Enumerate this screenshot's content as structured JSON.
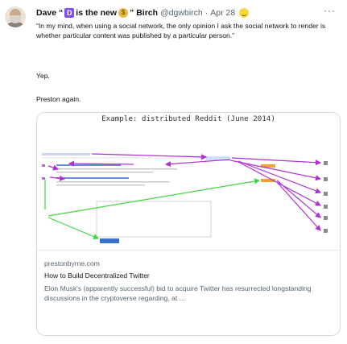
{
  "tweet": {
    "author_name_pre": "Dave “",
    "author_badge": "D",
    "author_name_mid": " is the new ",
    "author_bag": "$",
    "author_name_post": "” Birch",
    "handle": "@dgwbirch",
    "separator": "·",
    "date": "Apr 28",
    "more_label": "···",
    "quote": "“In my mind, when using a social network, the only opinion I ask the social network to render is whether particular content was published by a particular person.”",
    "reply1": "Yep.",
    "reply2": "Preston again."
  },
  "card": {
    "image_caption": "Example: distributed Reddit (June 2014)",
    "domain": "prestonbyrne.com",
    "title": "How to Build Decentralized Twitter",
    "description": "Elon Musk's (apparently successful) bid to acquire Twitter has resurrected longstanding discussions in the cryptoverse regarding, at ..."
  },
  "icons": {
    "avatar": "avatar-icon",
    "more": "more-icon",
    "emoji": "smiley-icon",
    "money_bag": "money-bag-icon"
  },
  "colors": {
    "arrow_purple": "#b030d8",
    "arrow_green": "#44d444",
    "highlight_orange": "#f0a030",
    "link_blue": "#3b6fd0"
  }
}
